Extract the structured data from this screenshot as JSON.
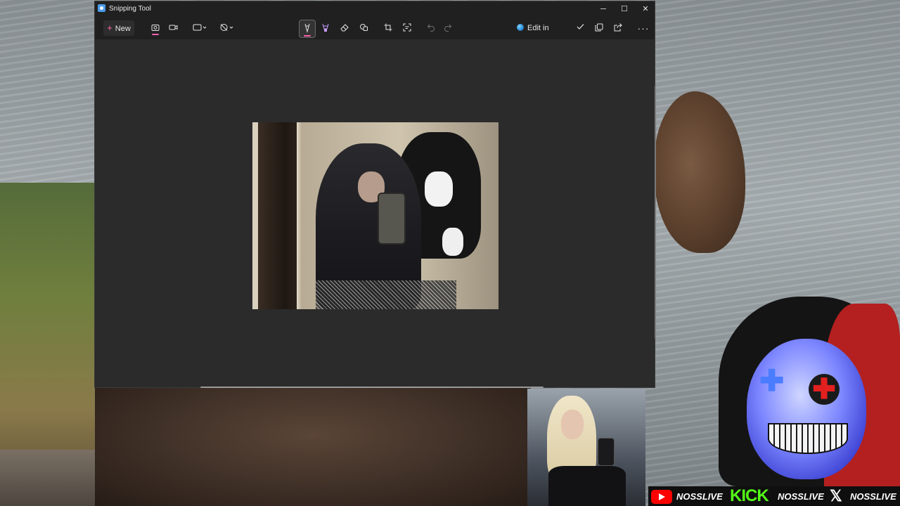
{
  "window": {
    "title": "Snipping Tool",
    "minimize_glyph": "─",
    "maximize_glyph": "☐",
    "close_glyph": "✕"
  },
  "toolbar": {
    "new_label": "New",
    "edit_in_paint_label": "Edit in Paint",
    "more_glyph": "···",
    "active_tool": "ballpoint-pen",
    "capture_mode": "snip",
    "accent_color": "#ff5fae"
  },
  "social": {
    "youtube_handle": "NOSSLIVE",
    "kick_logo_text": "KICK",
    "kick_handle": "NOSSLIVE",
    "x_logo_text": "𝕏",
    "x_handle": "NOSSLIVE",
    "kick_color": "#53fc18",
    "youtube_color": "#ff0000"
  },
  "avatar": {
    "eye_left_glyph": "✚",
    "eye_right_glyph": "✚"
  }
}
